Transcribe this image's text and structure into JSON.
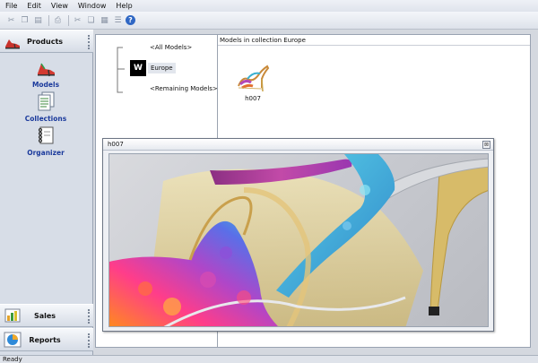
{
  "menu": [
    "File",
    "Edit",
    "View",
    "Window",
    "Help"
  ],
  "toolbar": {
    "buttons": [
      "cut-icon",
      "copy-icon",
      "paste-icon",
      "print-icon",
      "cut2-icon",
      "copy2-icon",
      "grid-icon",
      "list-icon",
      "help-icon"
    ],
    "help_glyph": "?"
  },
  "sidebar": {
    "products_header": "Products",
    "items": [
      {
        "label": "Models",
        "icon": "shoe-icon"
      },
      {
        "label": "Collections",
        "icon": "documents-icon"
      },
      {
        "label": "Organizer",
        "icon": "spiral-notebook-icon"
      }
    ],
    "sales_header": "Sales",
    "reports_header": "Reports"
  },
  "tree": {
    "all_models": "<All Models>",
    "europe_badge": "W",
    "europe": "Europe",
    "remaining": "<Remaining Models>"
  },
  "collection": {
    "header": "Models in collection Europe",
    "items": [
      {
        "label": "h007",
        "icon": "sandal-icon"
      }
    ]
  },
  "preview": {
    "title": "h007",
    "close_glyph": "⊠",
    "image": "sandal-closeup-image"
  },
  "status": "Ready"
}
